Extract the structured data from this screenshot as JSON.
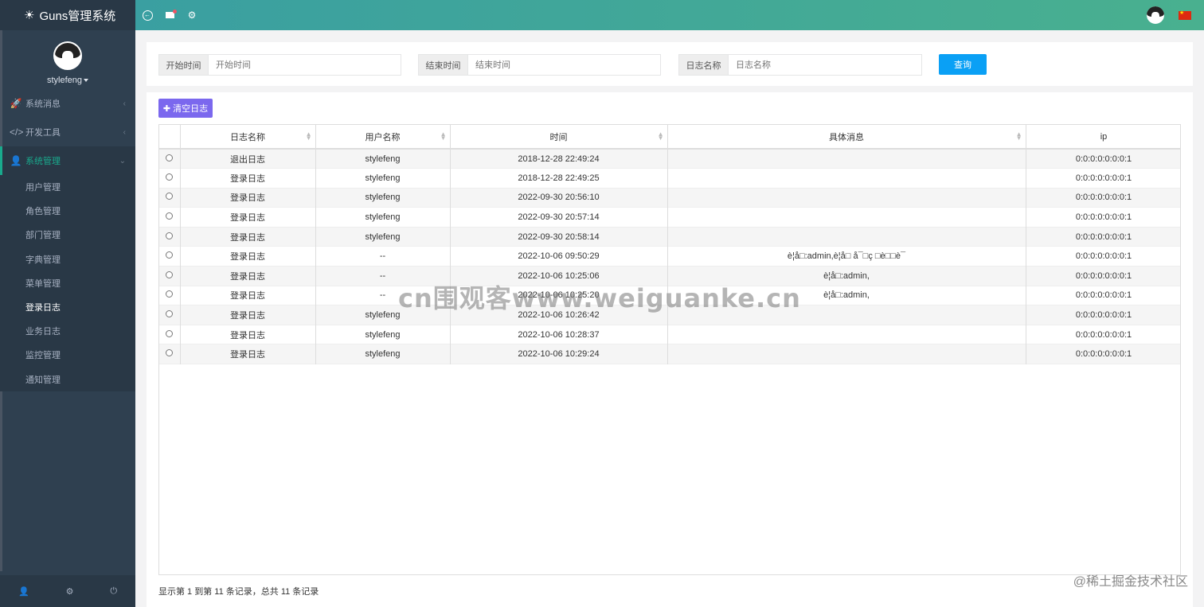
{
  "brand": {
    "title": "Guns管理系统"
  },
  "profile": {
    "username": "stylefeng"
  },
  "sidebar": {
    "items": [
      {
        "label": "系统消息"
      },
      {
        "label": "开发工具"
      },
      {
        "label": "系统管理"
      }
    ],
    "subitems": [
      {
        "label": "用户管理"
      },
      {
        "label": "角色管理"
      },
      {
        "label": "部门管理"
      },
      {
        "label": "字典管理"
      },
      {
        "label": "菜单管理"
      },
      {
        "label": "登录日志"
      },
      {
        "label": "业务日志"
      },
      {
        "label": "监控管理"
      },
      {
        "label": "通知管理"
      }
    ]
  },
  "search": {
    "start": {
      "label": "开始时间",
      "placeholder": "开始时间"
    },
    "end": {
      "label": "结束时间",
      "placeholder": "结束时间"
    },
    "logname": {
      "label": "日志名称",
      "placeholder": "日志名称"
    },
    "query_label": "查询"
  },
  "toolbar": {
    "clear_label": "清空日志"
  },
  "table": {
    "headers": [
      "日志名称",
      "用户名称",
      "时间",
      "具体消息",
      "ip"
    ],
    "rows": [
      [
        "退出日志",
        "stylefeng",
        "2018-12-28 22:49:24",
        "",
        "0:0:0:0:0:0:0:1"
      ],
      [
        "登录日志",
        "stylefeng",
        "2018-12-28 22:49:25",
        "",
        "0:0:0:0:0:0:0:1"
      ],
      [
        "登录日志",
        "stylefeng",
        "2022-09-30 20:56:10",
        "",
        "0:0:0:0:0:0:0:1"
      ],
      [
        "登录日志",
        "stylefeng",
        "2022-09-30 20:57:14",
        "",
        "0:0:0:0:0:0:0:1"
      ],
      [
        "登录日志",
        "stylefeng",
        "2022-09-30 20:58:14",
        "",
        "0:0:0:0:0:0:0:1"
      ],
      [
        "登录日志",
        "--",
        "2022-10-06 09:50:29",
        "è¦å□:admin,è¦å□ å¯□ç □è□□è¯",
        "0:0:0:0:0:0:0:1"
      ],
      [
        "登录日志",
        "--",
        "2022-10-06 10:25:06",
        "è¦å□:admin,",
        "0:0:0:0:0:0:0:1"
      ],
      [
        "登录日志",
        "--",
        "2022-10-06 10:25:20",
        "è¦å□:admin,",
        "0:0:0:0:0:0:0:1"
      ],
      [
        "登录日志",
        "stylefeng",
        "2022-10-06 10:26:42",
        "",
        "0:0:0:0:0:0:0:1"
      ],
      [
        "登录日志",
        "stylefeng",
        "2022-10-06 10:28:37",
        "",
        "0:0:0:0:0:0:0:1"
      ],
      [
        "登录日志",
        "stylefeng",
        "2022-10-06 10:29:24",
        "",
        "0:0:0:0:0:0:0:1"
      ]
    ]
  },
  "pager": {
    "text": "显示第 1 到第 11 条记录，总共 11 条记录"
  },
  "watermarks": {
    "center": "cn围观客www.weiguanke.cn",
    "corner": "@稀土掘金技术社区"
  },
  "colors": {
    "sidebar": "#2f4050",
    "accent": "#19aa8d",
    "query": "#0aa0f5",
    "clear": "#7b68ee"
  }
}
